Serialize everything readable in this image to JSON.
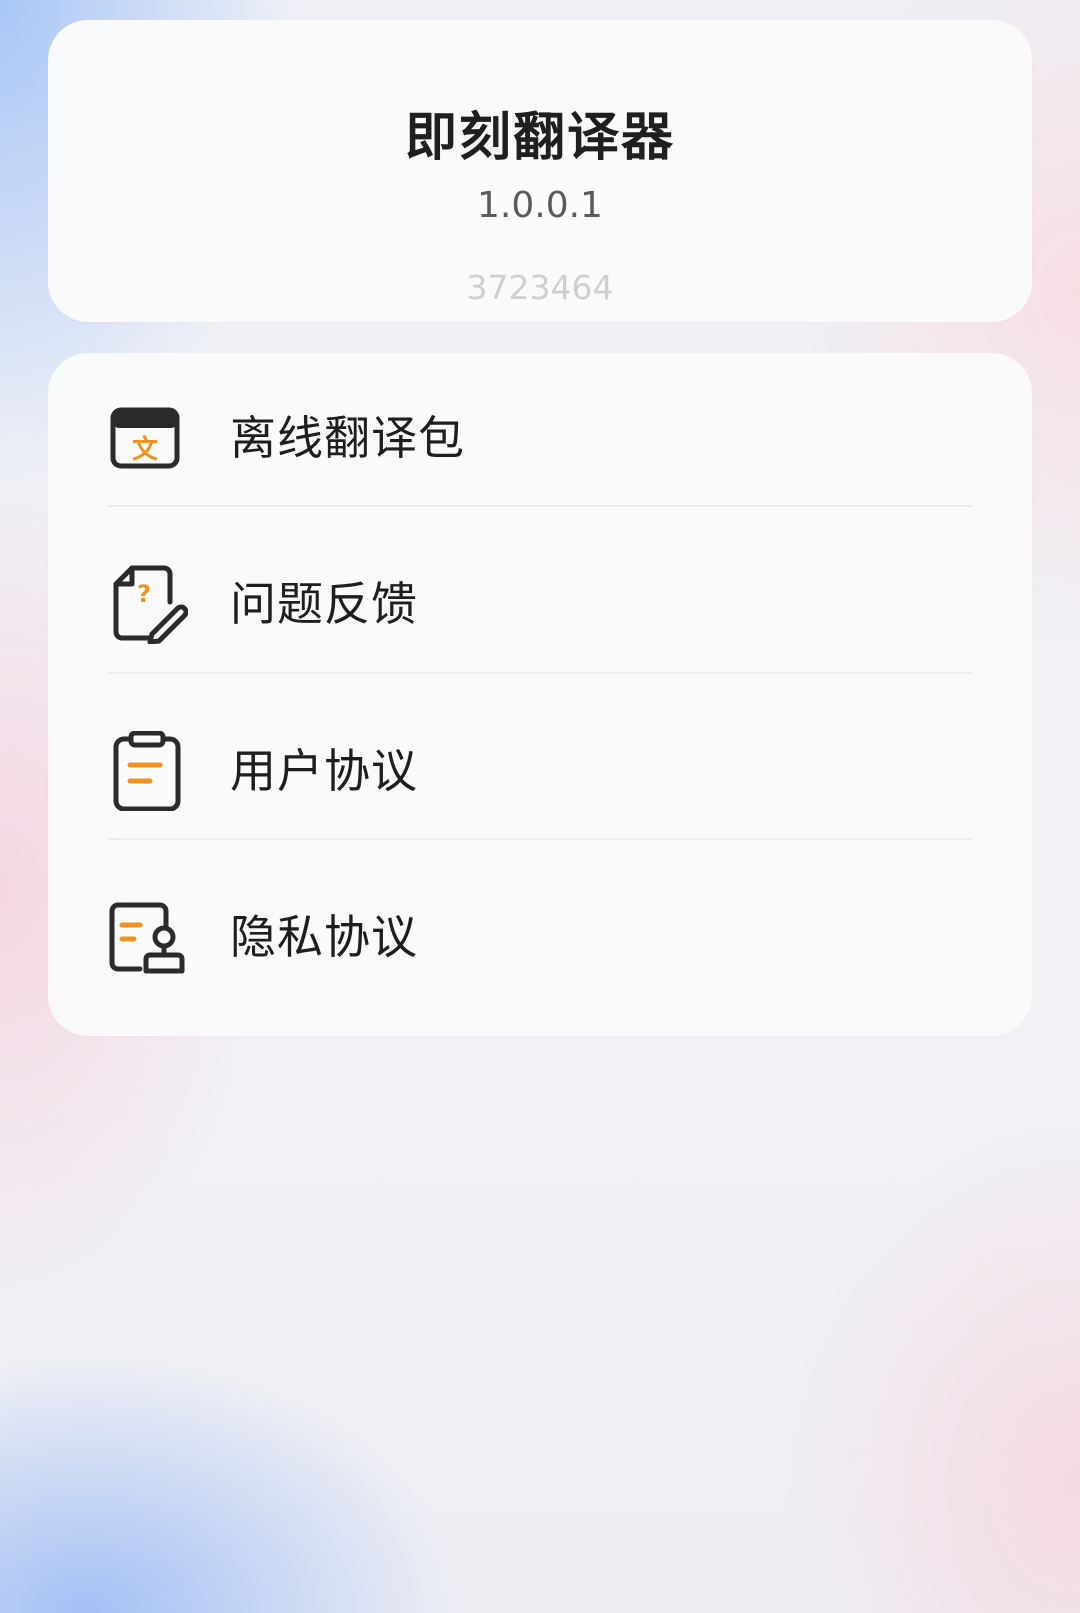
{
  "app": {
    "name": "即刻翻译器",
    "version": "1.0.0.1",
    "build": "3723464"
  },
  "menu": {
    "items": [
      {
        "label": "离线翻译包",
        "icon": "offline-pack-icon"
      },
      {
        "label": "问题反馈",
        "icon": "feedback-icon"
      },
      {
        "label": "用户协议",
        "icon": "user-agreement-icon"
      },
      {
        "label": "隐私协议",
        "icon": "privacy-agreement-icon"
      }
    ]
  },
  "colors": {
    "accent": "#f0931e",
    "icon_stroke": "#2b2b2b",
    "text_primary": "#1f1f1f",
    "text_secondary": "#5a5a5a",
    "text_muted": "#cfcfcf"
  }
}
